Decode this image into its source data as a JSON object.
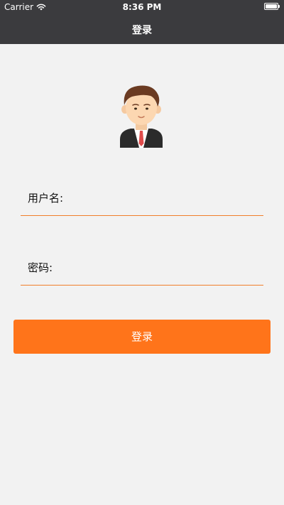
{
  "status_bar": {
    "carrier": "Carrier",
    "time": "8:36 PM",
    "wifi_icon": "wifi-icon",
    "battery_icon": "battery-icon"
  },
  "nav": {
    "title": "登录"
  },
  "avatar": {
    "icon": "businessman-avatar-icon"
  },
  "form": {
    "username": {
      "label": "用户名:",
      "value": ""
    },
    "password": {
      "label": "密码:",
      "value": ""
    }
  },
  "login_button": {
    "label": "登录"
  },
  "colors": {
    "nav_bg": "#3b3b3e",
    "page_bg": "#f2f2f2",
    "accent": "#ff741a",
    "underline": "#f07f2b"
  }
}
